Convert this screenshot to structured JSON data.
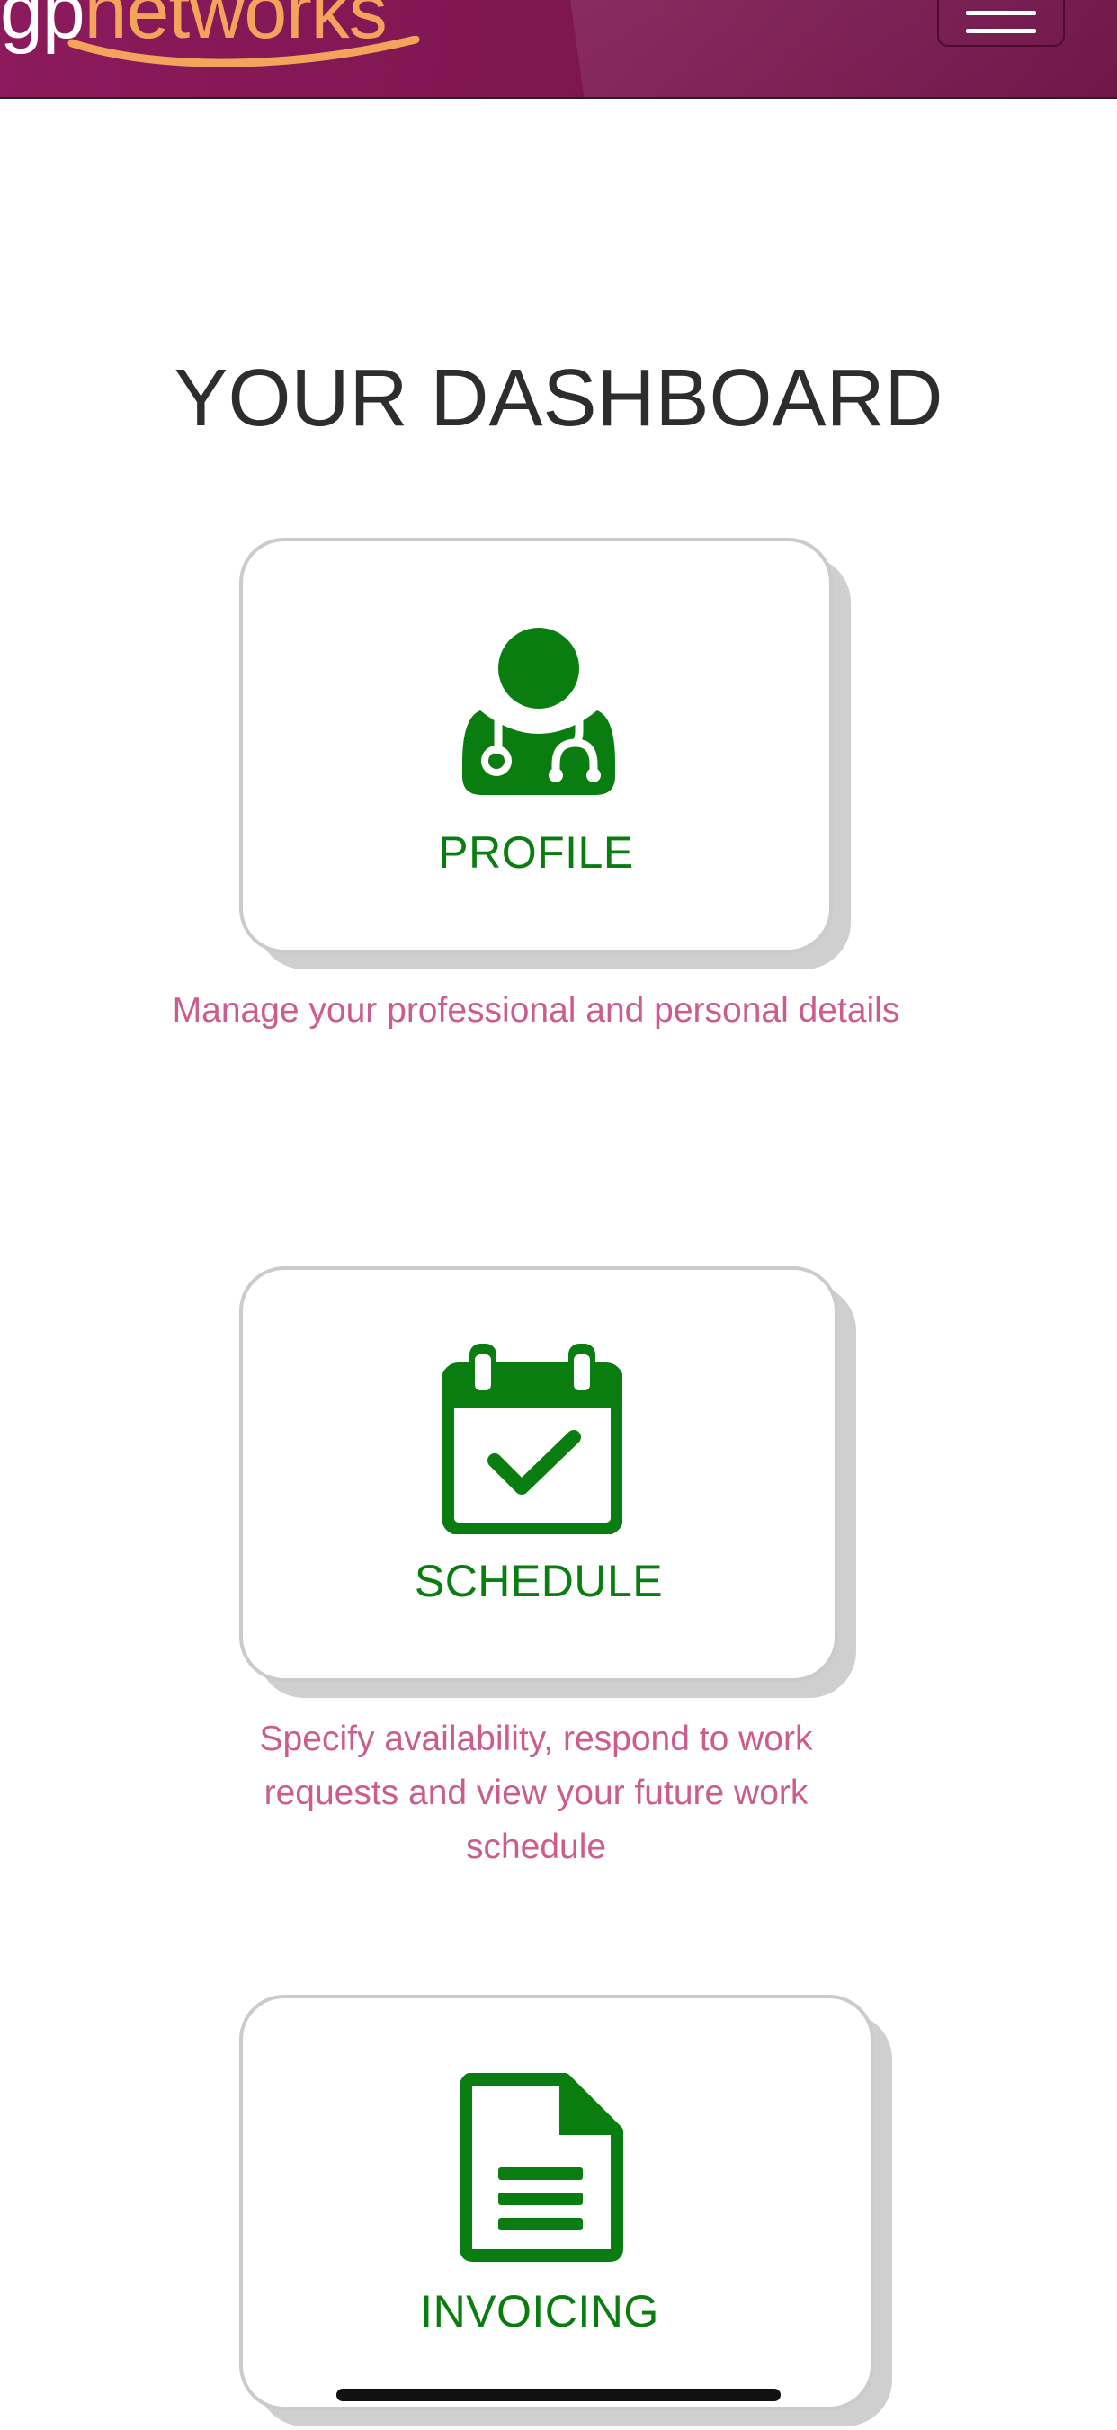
{
  "header": {
    "logo_text_a": "gp",
    "logo_text_b": "networks",
    "menu_icon": "hamburger-icon",
    "colors": {
      "brand": "#7c1650",
      "logo_accent": "#f4a35c"
    }
  },
  "page": {
    "title": "YOUR DASHBOARD"
  },
  "cards": [
    {
      "label": "PROFILE",
      "icon": "doctor-icon",
      "description": "Manage your professional and personal details"
    },
    {
      "label": "SCHEDULE",
      "icon": "calendar-check-icon",
      "description": "Specify availability, respond to work requests and view your future work schedule"
    },
    {
      "label": "INVOICING",
      "icon": "document-icon",
      "description": ""
    }
  ],
  "colors": {
    "accent_green": "#0a7d10",
    "description_pink": "#cc5c8e",
    "title_text": "#2d2d2d"
  }
}
